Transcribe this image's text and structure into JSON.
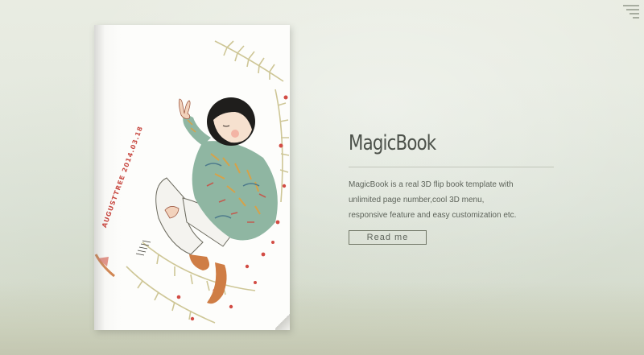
{
  "menu": {
    "icon": "filter-lines-icon"
  },
  "book": {
    "cover_illustration": "girl-in-sweater-illustration",
    "date_stamp": "AUGUSTTREE 2014.03.18"
  },
  "hero": {
    "title": "MagicBook",
    "description": "MagicBook is a real 3D flip book template with unlimited page number,cool 3D menu, responsive feature and easy customization etc.",
    "cta_label": "Read me"
  },
  "colors": {
    "accent_red": "#c84a43",
    "text": "#5e645b",
    "title": "#4d524b"
  }
}
